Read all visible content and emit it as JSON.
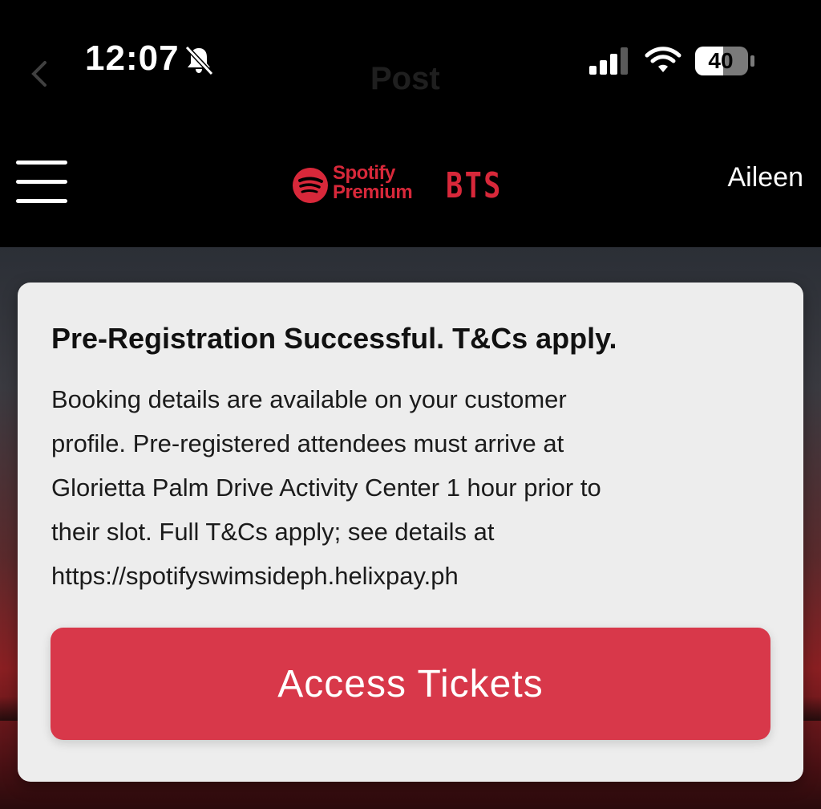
{
  "status_bar": {
    "time": "12:07",
    "battery_level": "40",
    "icons": [
      "bell-slash-icon",
      "cellular-signal-icon",
      "wifi-icon",
      "battery-icon"
    ]
  },
  "background_nav": {
    "title": "Post"
  },
  "header": {
    "brand_line1": "Spotify",
    "brand_line2": "Premium",
    "brand_artist": "BTS",
    "user_name": "Aileen",
    "brand_color": "#d8283a"
  },
  "card": {
    "title": "Pre-Registration Successful. T&Cs apply.",
    "body_lines": [
      "Booking details are available on your customer",
      "profile. Pre-registered attendees must arrive at",
      "Glorietta Palm Drive Activity Center 1 hour prior to",
      "their slot. Full T&Cs apply; see details at",
      "https://spotifyswimsideph.helixpay.ph"
    ],
    "button_label": "Access Tickets",
    "button_color": "#d8384a"
  }
}
